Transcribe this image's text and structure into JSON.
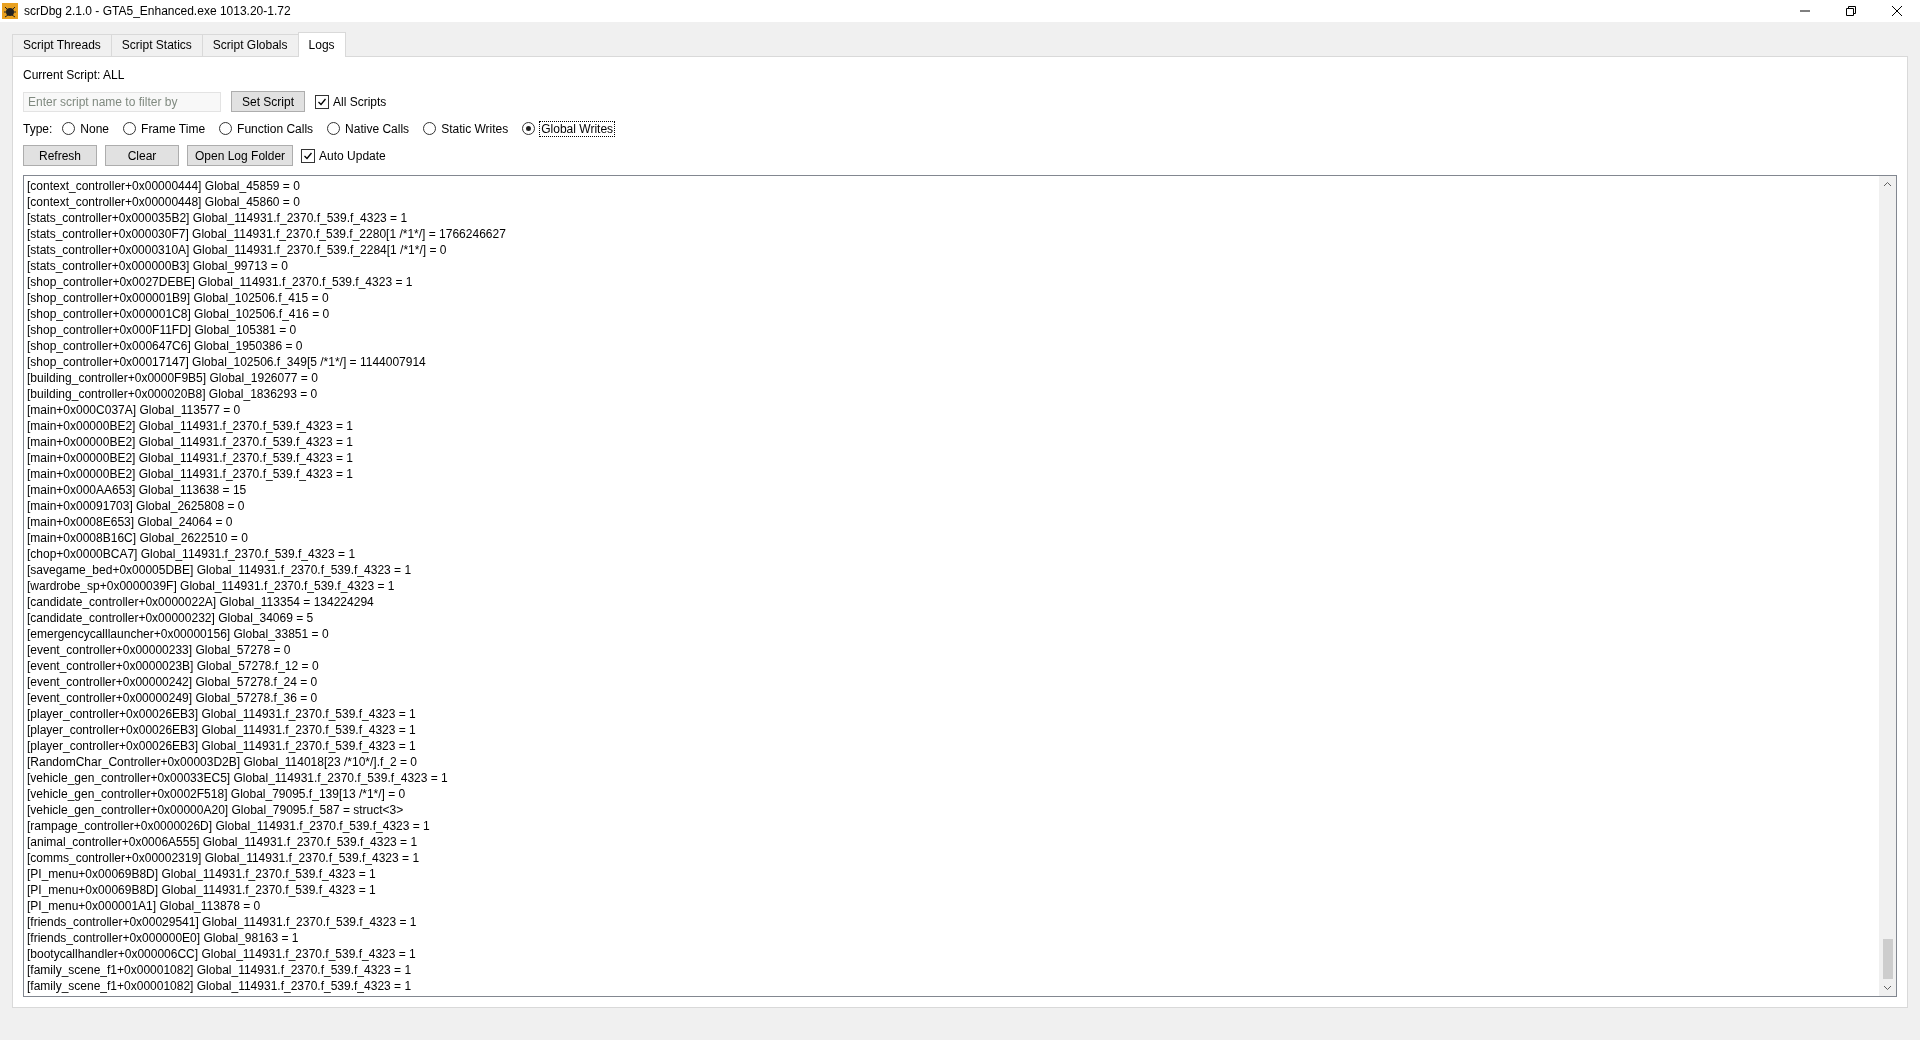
{
  "window": {
    "title": "scrDbg 2.1.0 - GTA5_Enhanced.exe 1013.20-1.72"
  },
  "tabs": [
    {
      "label": "Script Threads",
      "selected": false
    },
    {
      "label": "Script Statics",
      "selected": false
    },
    {
      "label": "Script Globals",
      "selected": false
    },
    {
      "label": "Logs",
      "selected": true
    }
  ],
  "current_script": "Current Script: ALL",
  "filter": {
    "placeholder": "Enter script name to filter by",
    "button": "Set Script",
    "all_scripts": {
      "label": "All Scripts",
      "checked": true
    }
  },
  "type": {
    "label": "Type:",
    "options": [
      {
        "label": "None",
        "selected": false
      },
      {
        "label": "Frame Time",
        "selected": false
      },
      {
        "label": "Function Calls",
        "selected": false
      },
      {
        "label": "Native Calls",
        "selected": false
      },
      {
        "label": "Static Writes",
        "selected": false
      },
      {
        "label": "Global Writes",
        "selected": true
      }
    ]
  },
  "actions": {
    "buttons": [
      "Refresh",
      "Clear",
      "Open Log Folder"
    ],
    "auto_update": {
      "label": "Auto Update",
      "checked": true
    }
  },
  "log_lines": [
    "[context_controller+0x00000444] Global_45859 = 0",
    "[context_controller+0x00000448] Global_45860 = 0",
    "[stats_controller+0x000035B2] Global_114931.f_2370.f_539.f_4323 = 1",
    "[stats_controller+0x000030F7] Global_114931.f_2370.f_539.f_2280[1 /*1*/] = 1766246627",
    "[stats_controller+0x0000310A] Global_114931.f_2370.f_539.f_2284[1 /*1*/] = 0",
    "[stats_controller+0x000000B3] Global_99713 = 0",
    "[shop_controller+0x0027DEBE] Global_114931.f_2370.f_539.f_4323 = 1",
    "[shop_controller+0x000001B9] Global_102506.f_415 = 0",
    "[shop_controller+0x000001C8] Global_102506.f_416 = 0",
    "[shop_controller+0x000F11FD] Global_105381 = 0",
    "[shop_controller+0x000647C6] Global_1950386 = 0",
    "[shop_controller+0x00017147] Global_102506.f_349[5 /*1*/] = 1144007914",
    "[building_controller+0x0000F9B5] Global_1926077 = 0",
    "[building_controller+0x000020B8] Global_1836293 = 0",
    "[main+0x000C037A] Global_113577 = 0",
    "[main+0x00000BE2] Global_114931.f_2370.f_539.f_4323 = 1",
    "[main+0x00000BE2] Global_114931.f_2370.f_539.f_4323 = 1",
    "[main+0x00000BE2] Global_114931.f_2370.f_539.f_4323 = 1",
    "[main+0x00000BE2] Global_114931.f_2370.f_539.f_4323 = 1",
    "[main+0x000AA653] Global_113638 = 15",
    "[main+0x00091703] Global_2625808 = 0",
    "[main+0x0008E653] Global_24064 = 0",
    "[main+0x0008B16C] Global_2622510 = 0",
    "[chop+0x0000BCA7] Global_114931.f_2370.f_539.f_4323 = 1",
    "[savegame_bed+0x00005DBE] Global_114931.f_2370.f_539.f_4323 = 1",
    "[wardrobe_sp+0x0000039F] Global_114931.f_2370.f_539.f_4323 = 1",
    "[candidate_controller+0x0000022A] Global_113354 = 134224294",
    "[candidate_controller+0x00000232] Global_34069 = 5",
    "[emergencycalllauncher+0x00000156] Global_33851 = 0",
    "[event_controller+0x00000233] Global_57278 = 0",
    "[event_controller+0x0000023B] Global_57278.f_12 = 0",
    "[event_controller+0x00000242] Global_57278.f_24 = 0",
    "[event_controller+0x00000249] Global_57278.f_36 = 0",
    "[player_controller+0x00026EB3] Global_114931.f_2370.f_539.f_4323 = 1",
    "[player_controller+0x00026EB3] Global_114931.f_2370.f_539.f_4323 = 1",
    "[player_controller+0x00026EB3] Global_114931.f_2370.f_539.f_4323 = 1",
    "[RandomChar_Controller+0x00003D2B] Global_114018[23 /*10*/].f_2 = 0",
    "[vehicle_gen_controller+0x00033EC5] Global_114931.f_2370.f_539.f_4323 = 1",
    "[vehicle_gen_controller+0x0002F518] Global_79095.f_139[13 /*1*/] = 0",
    "[vehicle_gen_controller+0x00000A20] Global_79095.f_587 = struct<3>",
    "[rampage_controller+0x0000026D] Global_114931.f_2370.f_539.f_4323 = 1",
    "[animal_controller+0x0006A555] Global_114931.f_2370.f_539.f_4323 = 1",
    "[comms_controller+0x00002319] Global_114931.f_2370.f_539.f_4323 = 1",
    "[PI_menu+0x00069B8D] Global_114931.f_2370.f_539.f_4323 = 1",
    "[PI_menu+0x00069B8D] Global_114931.f_2370.f_539.f_4323 = 1",
    "[PI_menu+0x000001A1] Global_113878 = 0",
    "[friends_controller+0x00029541] Global_114931.f_2370.f_539.f_4323 = 1",
    "[friends_controller+0x000000E0] Global_98163 = 1",
    "[bootycallhandler+0x000006CC] Global_114931.f_2370.f_539.f_4323 = 1",
    "[family_scene_f1+0x00001082] Global_114931.f_2370.f_539.f_4323 = 1",
    "[family_scene_f1+0x00001082] Global_114931.f_2370.f_539.f_4323 = 1"
  ]
}
